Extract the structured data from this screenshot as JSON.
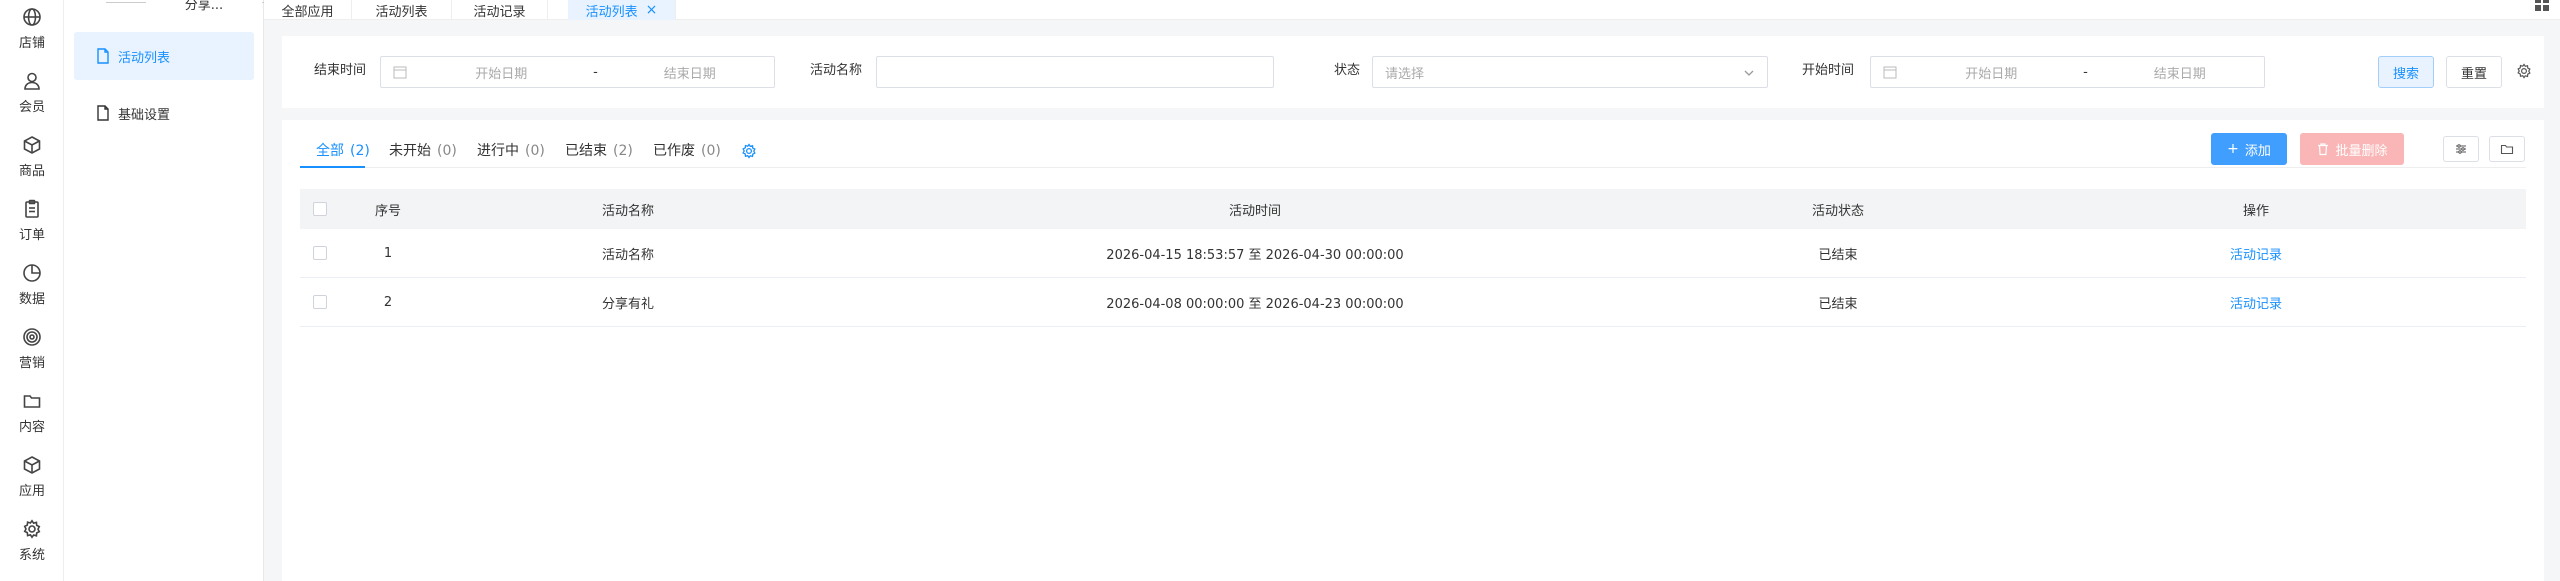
{
  "rail": [
    {
      "icon": "globe-icon",
      "label": "店铺"
    },
    {
      "icon": "user-icon",
      "label": "会员"
    },
    {
      "icon": "box-icon",
      "label": "商品"
    },
    {
      "icon": "clipboard-icon",
      "label": "订单"
    },
    {
      "icon": "pie-chart-icon",
      "label": "数据"
    },
    {
      "icon": "target-icon",
      "label": "营销"
    },
    {
      "icon": "folder-icon",
      "label": "内容"
    },
    {
      "icon": "cube-icon",
      "label": "应用"
    },
    {
      "icon": "gear-icon",
      "label": "系统"
    }
  ],
  "submenu": {
    "title": "分享...",
    "items": [
      {
        "label": "活动列表",
        "active": true
      },
      {
        "label": "基础设置",
        "active": false
      }
    ]
  },
  "tabs": [
    {
      "label": "全部应用"
    },
    {
      "label": "活动列表"
    },
    {
      "label": "活动记录"
    },
    {
      "label": "活动列表",
      "active": true,
      "close": "×"
    }
  ],
  "filters": {
    "end_time_label": "结束时间",
    "end_time_start_placeholder": "开始日期",
    "end_time_end_placeholder": "结束日期",
    "range_sep": "-",
    "name_label": "活动名称",
    "name_value": "",
    "status_label": "状态",
    "status_placeholder": "请选择",
    "start_time_label": "开始时间",
    "start_time_start_placeholder": "开始日期",
    "start_time_end_placeholder": "结束日期",
    "search_button": "搜索",
    "reset_button": "重置"
  },
  "status_tabs": [
    {
      "label": "全部",
      "count": "(2)",
      "active": true
    },
    {
      "label": "未开始",
      "count": "(0)"
    },
    {
      "label": "进行中",
      "count": "(0)"
    },
    {
      "label": "已结束",
      "count": "(2)"
    },
    {
      "label": "已作废",
      "count": "(0)"
    }
  ],
  "toolbar": {
    "add_button": "添加",
    "batch_delete_button": "批量删除"
  },
  "table": {
    "columns": [
      "序号",
      "活动名称",
      "活动时间",
      "活动状态",
      "操作"
    ],
    "rows": [
      {
        "index": "1",
        "name": "活动名称",
        "time": "2026-04-15 18:53:57 至 2026-04-30 00:00:00",
        "status": "已结束",
        "action": "活动记录"
      },
      {
        "index": "2",
        "name": "分享有礼",
        "time": "2026-04-08 00:00:00 至 2026-04-23 00:00:00",
        "status": "已结束",
        "action": "活动记录"
      }
    ]
  },
  "colors": {
    "accent": "#1890ff",
    "danger_disabled": "#fab6b6",
    "primary": "#409eff"
  }
}
